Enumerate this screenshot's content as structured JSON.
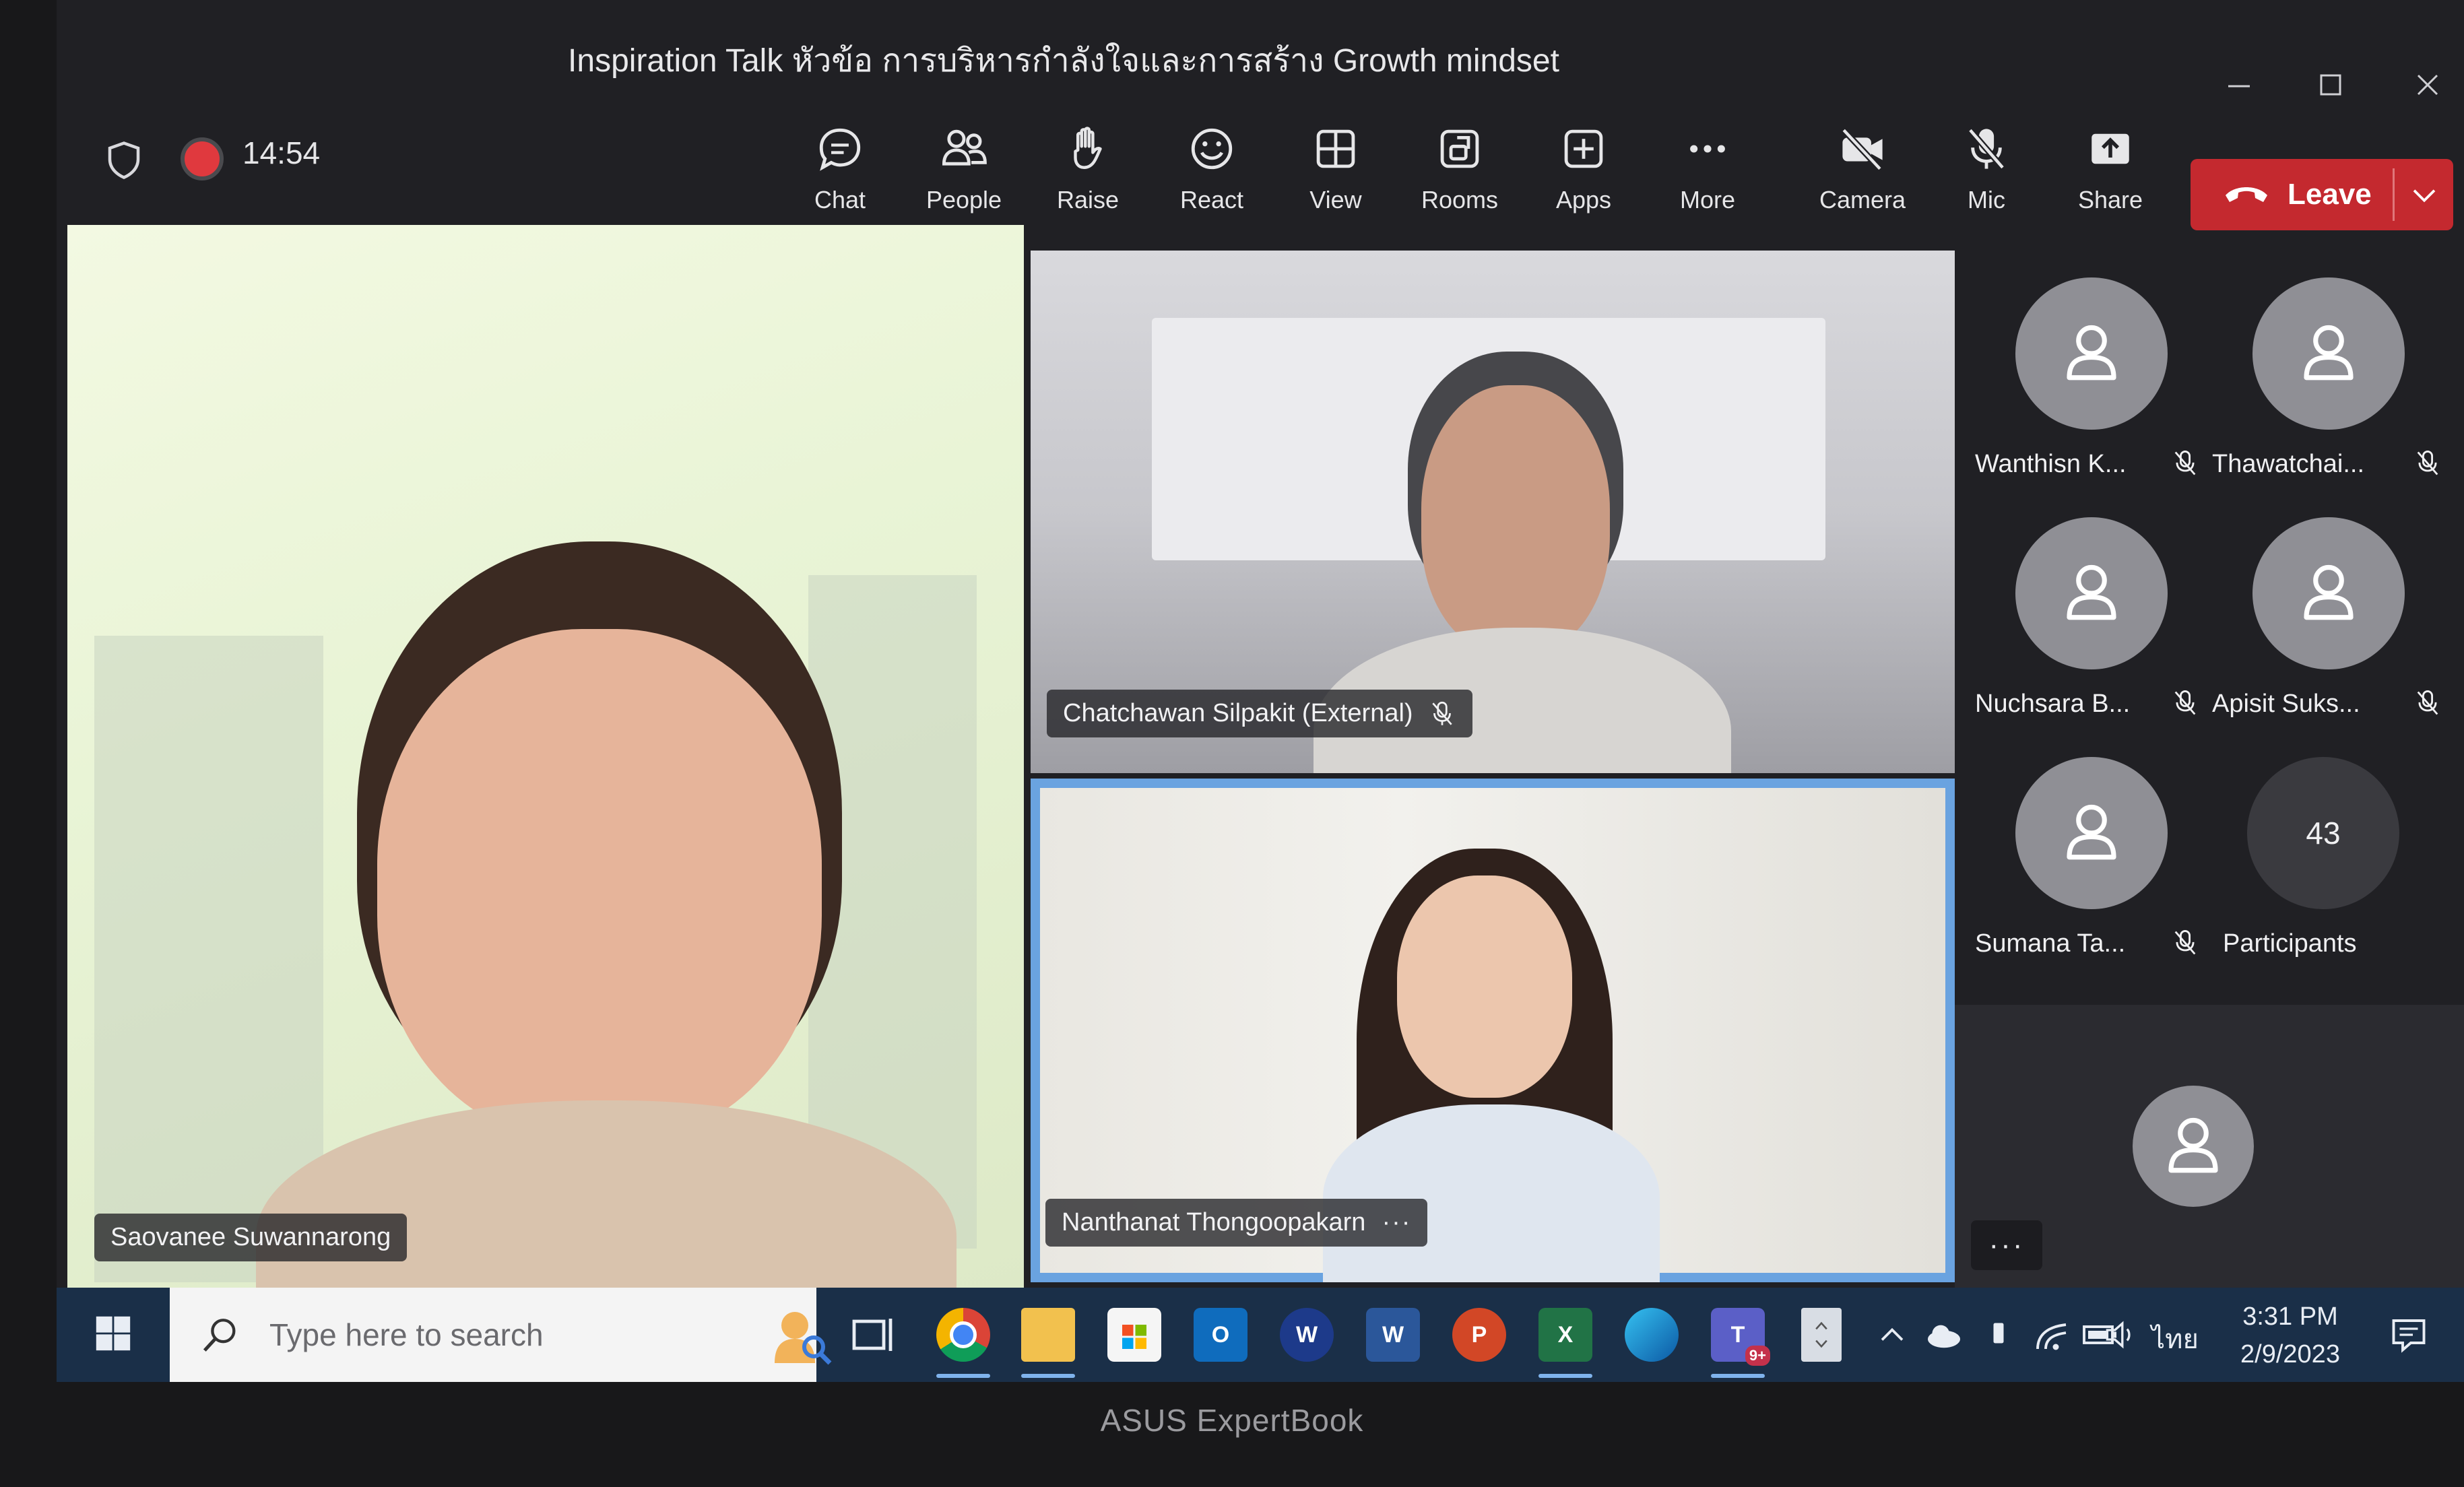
{
  "window": {
    "title": "Inspiration Talk หัวข้อ การบริหารกำลังใจและการสร้าง Growth mindset",
    "device_brand": "ASUS ExpertBook"
  },
  "meeting": {
    "elapsed": "14:54",
    "toolbar": {
      "chat": "Chat",
      "people": "People",
      "raise": "Raise",
      "react": "React",
      "view": "View",
      "rooms": "Rooms",
      "apps": "Apps",
      "more": "More",
      "camera": "Camera",
      "mic": "Mic",
      "share": "Share",
      "leave": "Leave"
    },
    "tiles": [
      {
        "name": "Saovanee Suwannarong"
      },
      {
        "name": "Chatchawan Silpakit (External)",
        "muted": true
      },
      {
        "name": "Nanthanat Thongoopakarn",
        "active": true
      }
    ],
    "roster": [
      {
        "name": "Wanthisn K...",
        "muted": true
      },
      {
        "name": "Thawatchai...",
        "muted": true
      },
      {
        "name": "Nuchsara B...",
        "muted": true
      },
      {
        "name": "Apisit Suks...",
        "muted": true
      },
      {
        "name": "Sumana Ta...",
        "muted": true
      }
    ],
    "participants": {
      "count": "43",
      "label": "Participants"
    },
    "more_dots": "···"
  },
  "taskbar": {
    "search_placeholder": "Type here to search",
    "language": "ไทย",
    "time": "3:31 PM",
    "date": "2/9/2023",
    "teams_badge": "9+"
  },
  "colors": {
    "leave_red": "#c4292f",
    "active_border": "#6aa3e0",
    "taskbar": "#1a2f48"
  }
}
